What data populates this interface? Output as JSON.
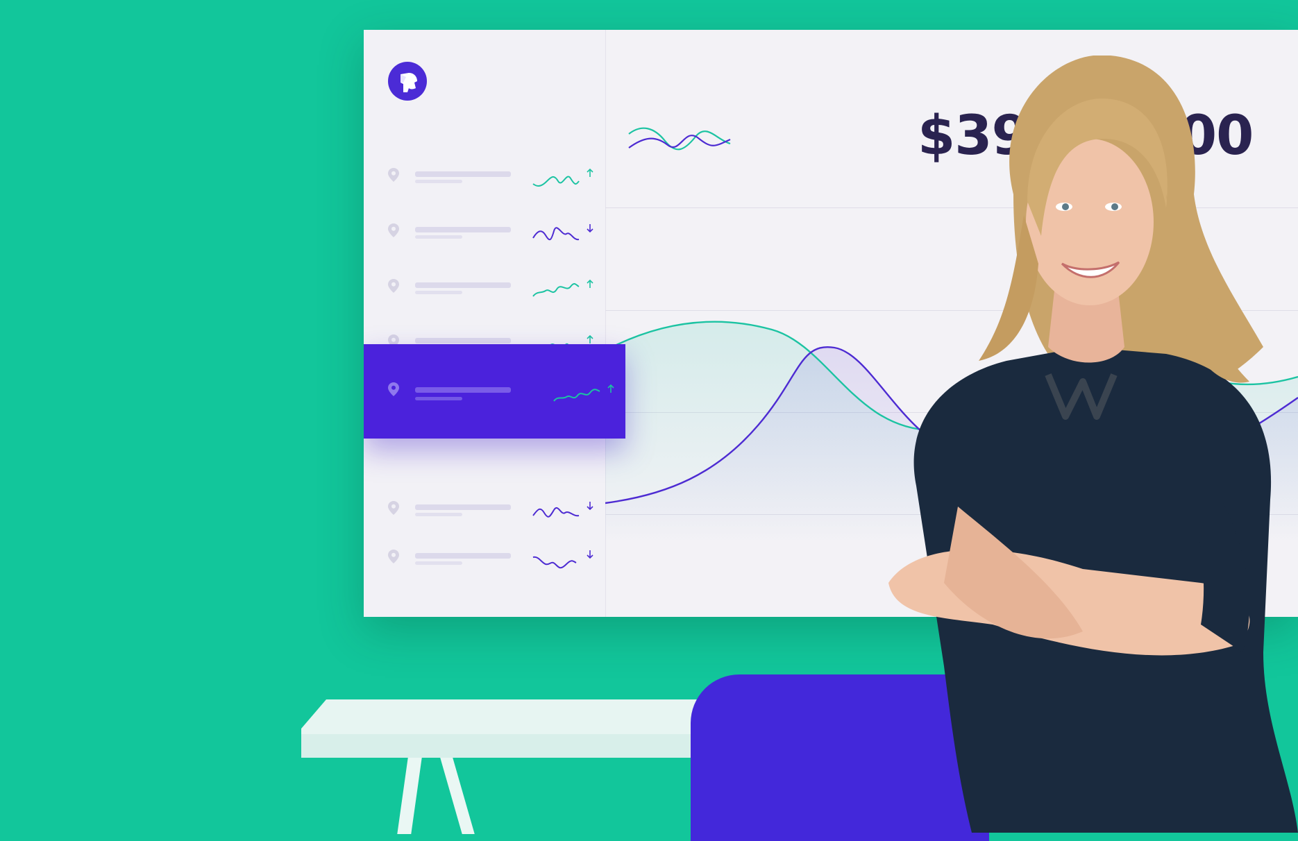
{
  "dashboard": {
    "total": "$394",
    "total_tail": ".00",
    "logo": "dog-logo-icon",
    "rows": [
      {
        "trend": "up",
        "spark_color": "#1cc3a2"
      },
      {
        "trend": "down",
        "spark_color": "#4d2bd2"
      },
      {
        "trend": "up",
        "spark_color": "#1cc3a2"
      },
      {
        "trend": "up",
        "spark_color": "#1cc3a2"
      },
      {
        "trend": "up",
        "spark_color": "#1cc3a2",
        "active": true
      },
      {
        "trend": "down",
        "spark_color": "#4d2bd2"
      },
      {
        "trend": "down",
        "spark_color": "#4d2bd2"
      }
    ]
  },
  "colors": {
    "background": "#12c69b",
    "accent": "#4b22dc",
    "teal": "#1cc3a2",
    "text": "#2a2350"
  },
  "scene": {
    "objects": [
      "person-photo",
      "desk",
      "chair"
    ]
  }
}
